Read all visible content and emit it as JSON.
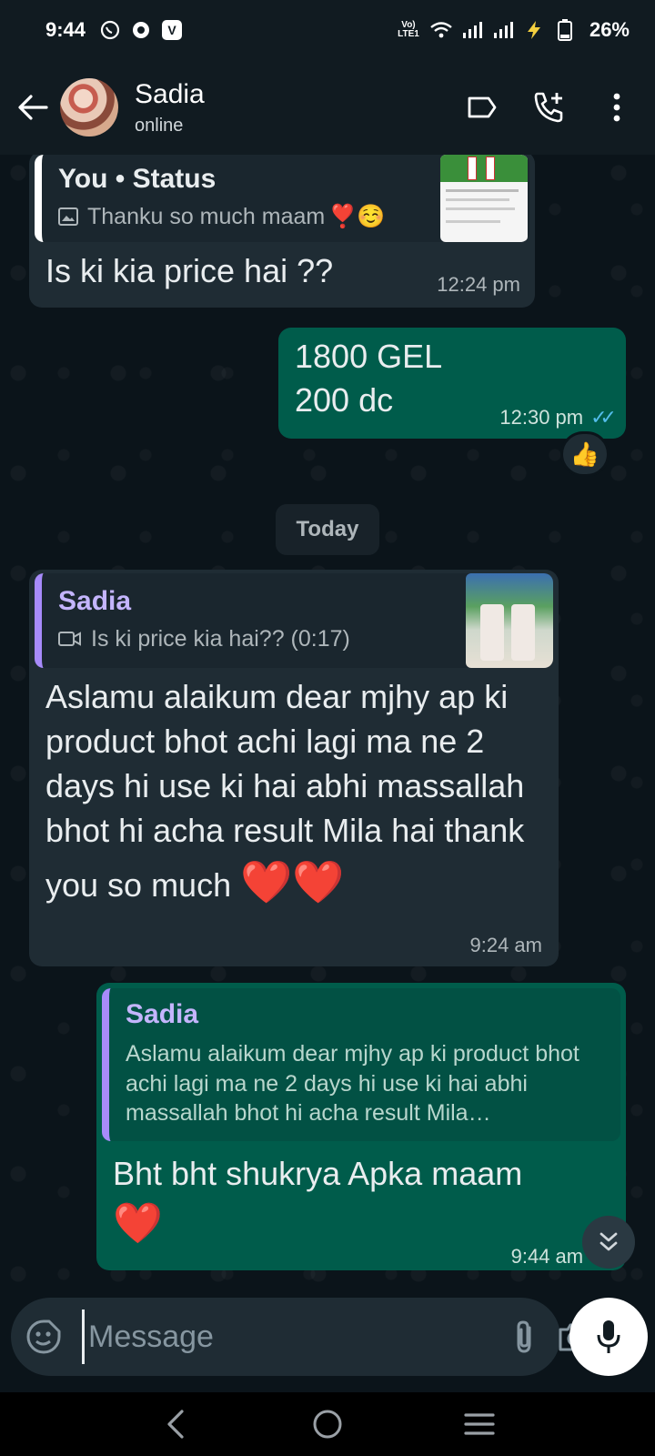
{
  "status_bar": {
    "time": "9:44",
    "battery": "26%",
    "volte_label": "Vo) LTE1",
    "app_badge": "V"
  },
  "header": {
    "contact_name": "Sadia",
    "presence": "online"
  },
  "messages": [
    {
      "direction": "incoming",
      "quote_author": "You • Status",
      "quote_text": "Thanku so much maam",
      "quote_emoji": "❣️☺️",
      "text": "Is ki kia price hai ??",
      "time": "12:24 pm"
    },
    {
      "direction": "outgoing",
      "text_line1": "1800 GEL",
      "text_line2": "200 dc",
      "time": "12:30 pm",
      "reaction": "👍"
    },
    {
      "direction": "incoming",
      "quote_author": "Sadia",
      "quote_text": "Is ki price kia hai?? (0:17)",
      "text": "Aslamu alaikum dear mjhy ap ki product bhot achi lagi ma ne 2 days hi use ki hai abhi massallah bhot hi acha result Mila hai thank you so much",
      "emoji": "❤️❤️",
      "time": "9:24 am"
    },
    {
      "direction": "outgoing",
      "quote_author": "Sadia",
      "quote_text": "Aslamu alaikum dear mjhy ap ki product bhot achi lagi ma ne 2 days hi use ki hai abhi massallah bhot hi acha result Mila…",
      "text": "Bht bht shukrya Apka maam",
      "emoji": "❤️",
      "time": "9:44 am"
    }
  ],
  "date_separator": "Today",
  "input": {
    "placeholder": "Message"
  },
  "colors": {
    "accent_out": "#005c4b",
    "incoming": "#1f2c34",
    "quote_you": "#ffffff",
    "quote_sadia": "#a78bfa",
    "read_ticks": "#53bdeb"
  }
}
